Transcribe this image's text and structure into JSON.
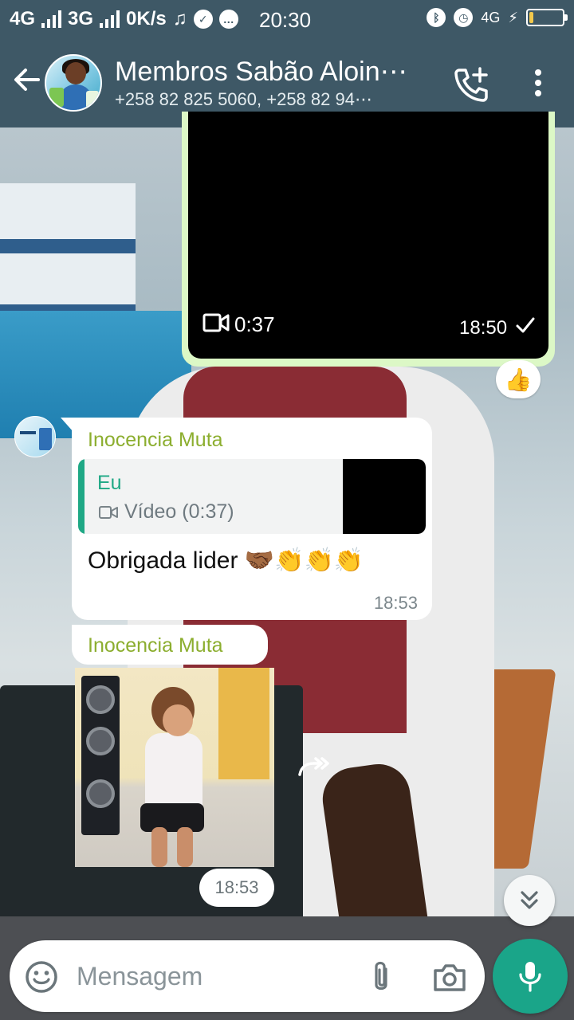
{
  "status_bar": {
    "network1": "4G",
    "network2": "3G",
    "speed": "0K/s",
    "time": "20:30",
    "network_right": "4G",
    "battery_level": 0.12,
    "icons": [
      "music-note-icon",
      "check-circle-icon",
      "chat-bubble-icon",
      "bluetooth-icon",
      "alarm-icon",
      "charging-icon"
    ]
  },
  "header": {
    "title": "Membros Sabão Aloin⋯",
    "subtitle": "+258 82 825 5060, +258 82 94⋯",
    "back_icon": "arrow-left-icon",
    "call_icon": "add-call-icon",
    "menu_icon": "more-vertical-icon"
  },
  "messages": {
    "video": {
      "duration": "0:37",
      "time": "18:50",
      "reaction": "👍"
    },
    "reply": {
      "sender": "Inocencia Muta",
      "quoted_author": "Eu",
      "quoted_text": "Vídeo (0:37)",
      "text": "Obrigada lider 🤝🏾👏👏👏",
      "time": "18:53"
    },
    "image": {
      "sender": "Inocencia Muta",
      "time": "18:53"
    }
  },
  "composer": {
    "placeholder": "Mensagem"
  },
  "colors": {
    "header": "#3e5866",
    "sent_bubble": "#dcf8c6",
    "sender_name": "#8cae2f",
    "quote_accent": "#1fa885",
    "mic_button": "#1aa589"
  }
}
